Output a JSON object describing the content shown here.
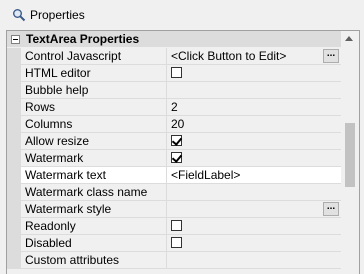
{
  "panel": {
    "title": "Properties",
    "icon": "magnifier-icon"
  },
  "category": {
    "label": "TextArea Properties"
  },
  "properties": [
    {
      "name": "Control Javascript",
      "value": "<Click Button to Edit>",
      "type": "text",
      "has_ellipsis": true
    },
    {
      "name": "HTML editor",
      "value": "",
      "type": "checkbox",
      "checked": false
    },
    {
      "name": "Bubble help",
      "value": "",
      "type": "text"
    },
    {
      "name": "Rows",
      "value": "2",
      "type": "text"
    },
    {
      "name": "Columns",
      "value": "20",
      "type": "text"
    },
    {
      "name": "Allow resize",
      "value": "",
      "type": "checkbox",
      "checked": true
    },
    {
      "name": "Watermark",
      "value": "",
      "type": "checkbox",
      "checked": true
    },
    {
      "name": "Watermark text",
      "value": "<FieldLabel>",
      "type": "text",
      "selected": true
    },
    {
      "name": "Watermark class name",
      "value": "",
      "type": "text"
    },
    {
      "name": "Watermark style",
      "value": "",
      "type": "text",
      "has_ellipsis": true
    },
    {
      "name": "Readonly",
      "value": "",
      "type": "checkbox",
      "checked": false
    },
    {
      "name": "Disabled",
      "value": "",
      "type": "checkbox",
      "checked": false
    },
    {
      "name": "Custom attributes",
      "value": "",
      "type": "text"
    }
  ],
  "ellipsis_label": "...",
  "colors": {
    "gutter": "#dcdcdc",
    "selected_row": "#ffffff",
    "background": "#f0f0f0"
  }
}
